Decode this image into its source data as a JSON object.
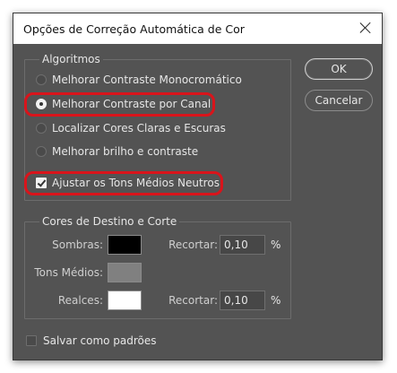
{
  "dialog": {
    "title": "Opções de Correção Automática de Cor"
  },
  "algorithms": {
    "legend": "Algoritmos",
    "options": [
      {
        "label": "Melhorar Contraste Monocromático",
        "selected": false
      },
      {
        "label": "Melhorar Contraste por Canal",
        "selected": true
      },
      {
        "label": "Localizar Cores Claras e Escuras",
        "selected": false
      },
      {
        "label": "Melhorar brilho e contraste",
        "selected": false
      }
    ],
    "neutral_midtones": {
      "label": "Ajustar os Tons Médios Neutros",
      "checked": true
    }
  },
  "buttons": {
    "ok": "OK",
    "cancel": "Cancelar"
  },
  "targets": {
    "legend": "Cores de Destino e Corte",
    "shadows": {
      "label": "Sombras:",
      "color": "#000000",
      "clip_label": "Recortar:",
      "clip_value": "0,10",
      "unit": "%"
    },
    "midtones": {
      "label": "Tons Médios:",
      "color": "#808080"
    },
    "highlights": {
      "label": "Realces:",
      "color": "#ffffff",
      "clip_label": "Recortar:",
      "clip_value": "0,10",
      "unit": "%"
    }
  },
  "save_defaults": {
    "label": "Salvar como padrões",
    "checked": false
  },
  "colors": {
    "dialog_bg": "#535353",
    "highlight_ring": "#d9141b"
  }
}
